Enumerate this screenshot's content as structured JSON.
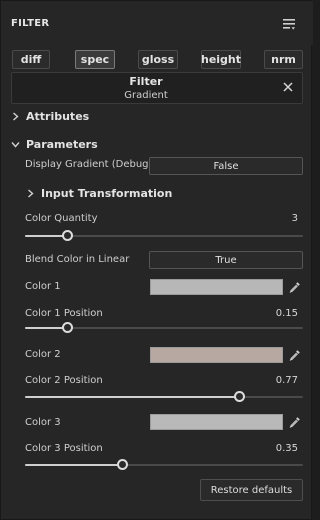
{
  "panel": {
    "title": "FILTER",
    "menu_icon": "hamburger-dropdown-icon"
  },
  "channels": [
    "diff",
    "spec",
    "gloss",
    "height",
    "nrm"
  ],
  "active_channel": "spec",
  "filter": {
    "title": "Filter",
    "name": "Gradient",
    "close_icon": "close-icon"
  },
  "sections": {
    "attributes": "Attributes",
    "parameters": "Parameters",
    "input_transformation": "Input Transformation"
  },
  "params": {
    "display_gradient_label": "Display Gradient (Debug)",
    "display_gradient_value": "False",
    "color_quantity_label": "Color Quantity",
    "color_quantity_value": "3",
    "color_quantity_fraction": 0.15,
    "blend_linear_label": "Blend Color in Linear",
    "blend_linear_value": "True"
  },
  "colors": [
    {
      "label": "Color 1",
      "swatch": "#b7b7b7",
      "position_label": "Color 1 Position",
      "position_value": "0.15",
      "position": 0.15
    },
    {
      "label": "Color 2",
      "swatch": "#b7a9a2",
      "position_label": "Color 2 Position",
      "position_value": "0.77",
      "position": 0.77
    },
    {
      "label": "Color 3",
      "swatch": "#b9b9b9",
      "position_label": "Color 3 Position",
      "position_value": "0.35",
      "position": 0.35
    }
  ],
  "restore_defaults": "Restore defaults"
}
